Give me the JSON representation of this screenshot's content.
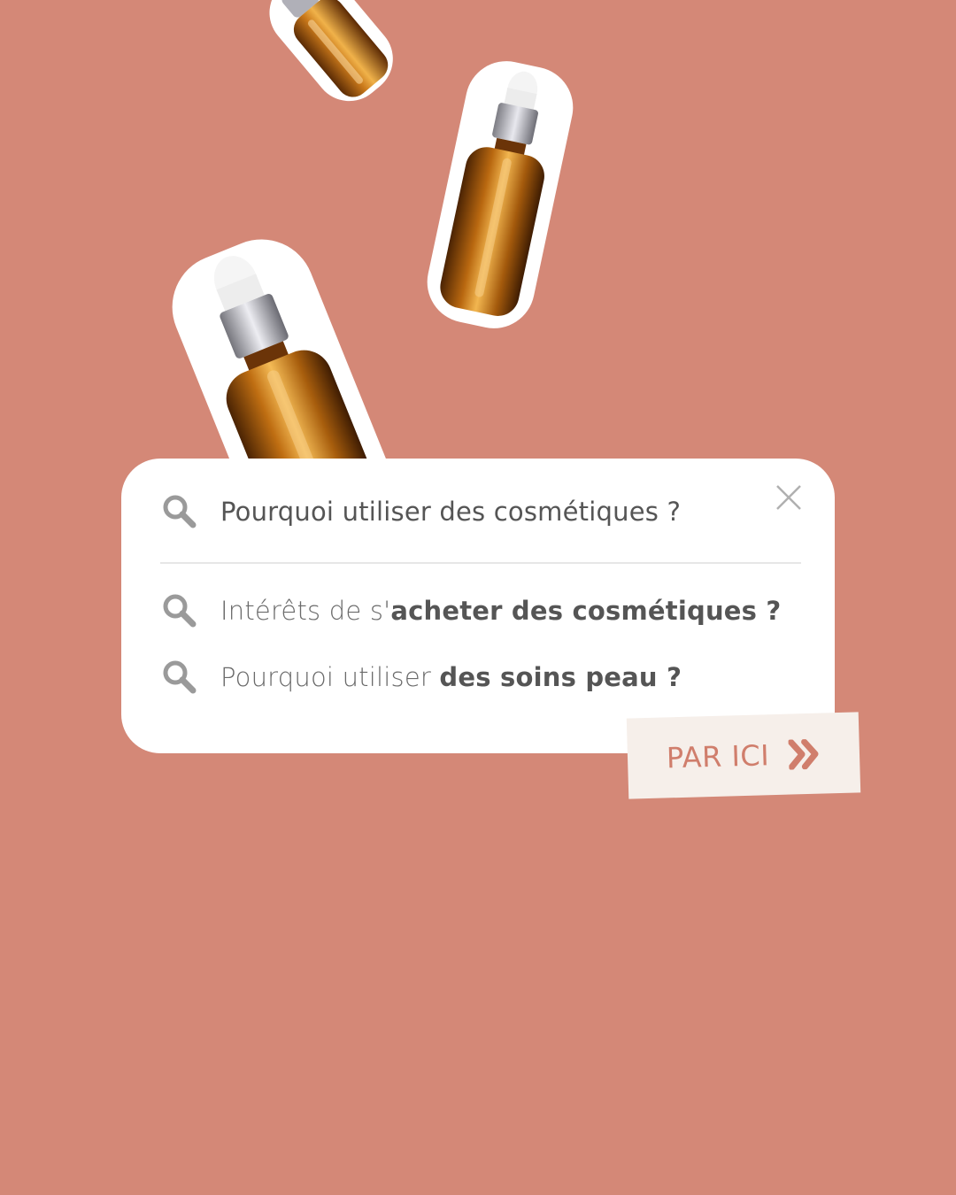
{
  "search": {
    "query": "Pourquoi utiliser des cosmétiques ?",
    "suggestions": [
      {
        "light": "Intérêts de s'",
        "bold": "acheter des cosmétiques ?"
      },
      {
        "light": "Pourquoi utiliser ",
        "bold": "des soins peau ?"
      }
    ]
  },
  "cta": {
    "label": "PAR ICI"
  },
  "icons": {
    "search": "search-icon",
    "close": "close-icon",
    "cta": "double-chevron-right-icon",
    "bottles": "dropper-bottle-icon"
  },
  "colors": {
    "background": "#d48877",
    "card": "#ffffff",
    "text": "#555555",
    "cta_background": "#f6efea",
    "cta_text": "#d07e6c",
    "bottle_glass": "#b8650f"
  }
}
